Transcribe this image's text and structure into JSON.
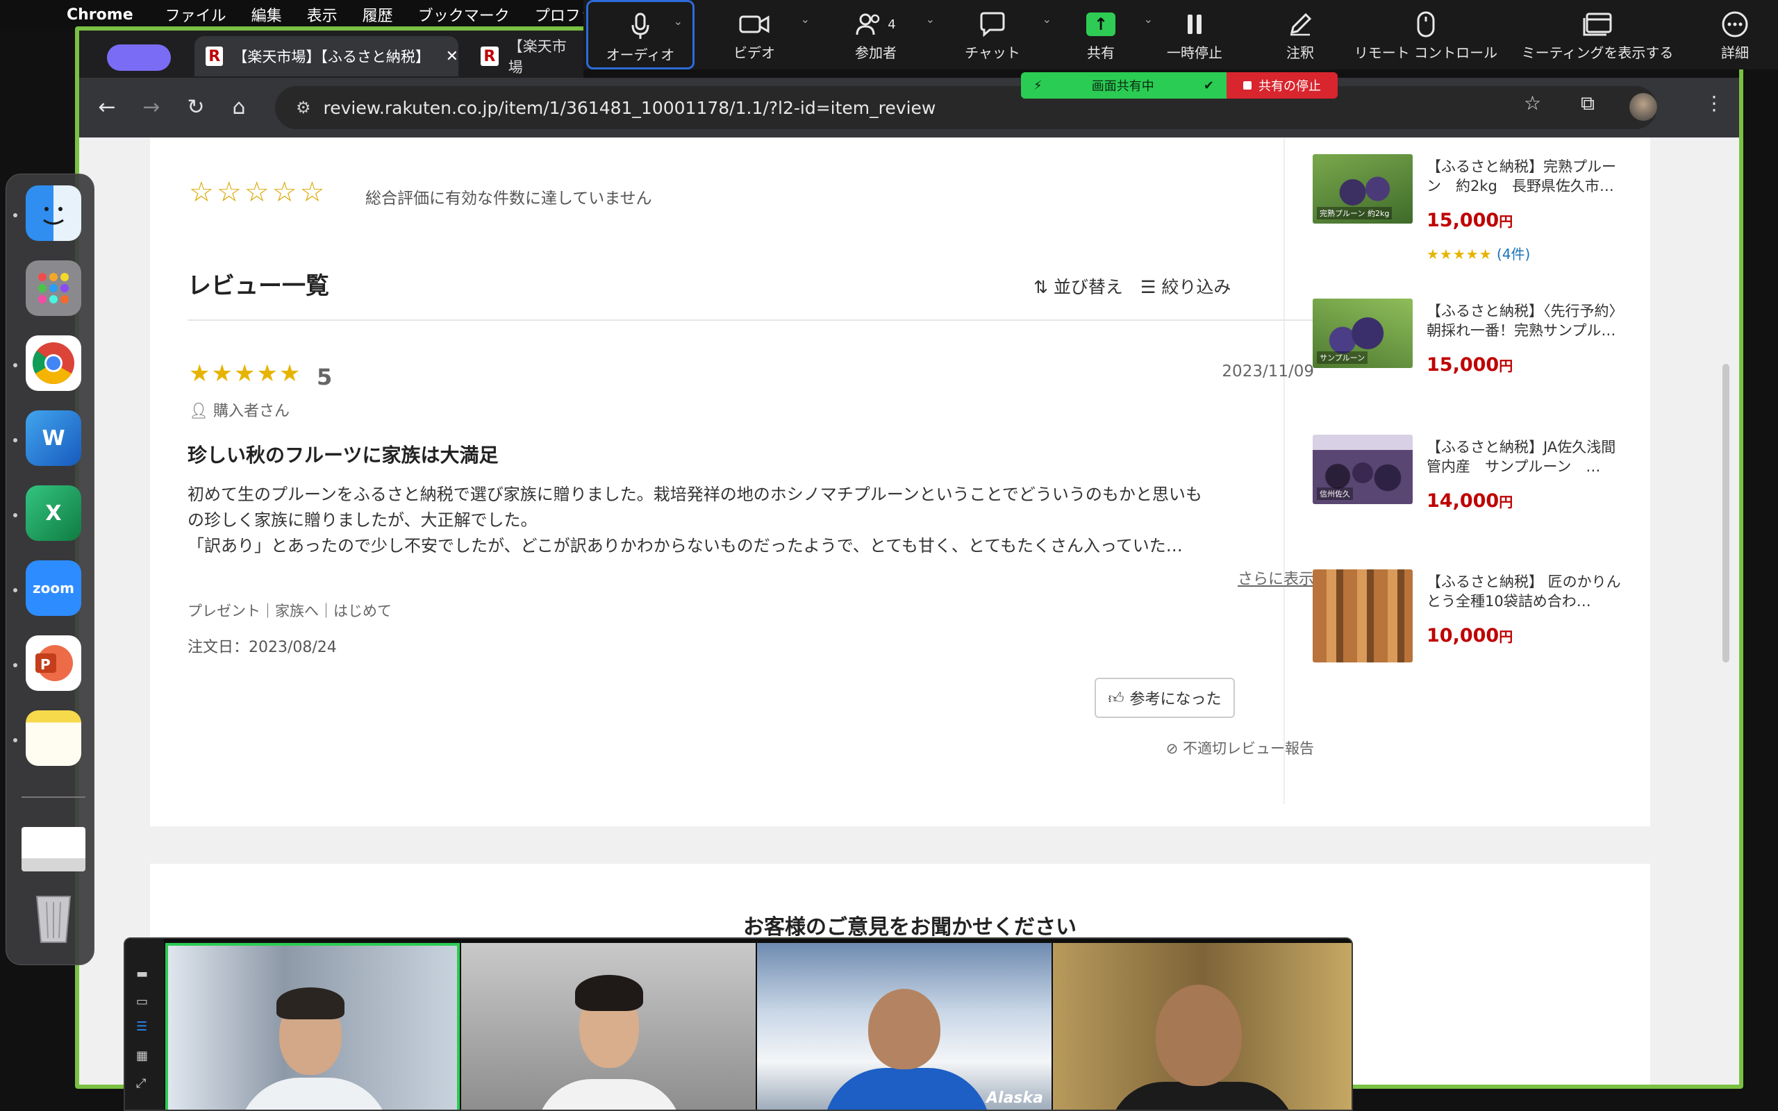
{
  "menubar": {
    "app": "Chrome",
    "menus": [
      "ファイル",
      "編集",
      "表示",
      "履歴",
      "ブックマーク",
      "プロファ"
    ]
  },
  "zoom": {
    "tools": {
      "audio": "オーディオ",
      "video": "ビデオ",
      "participants": "参加者",
      "participants_count": "4",
      "chat": "チャット",
      "share": "共有",
      "pause": "一時停止",
      "annotate": "注釈",
      "remote": "リモート コントロール",
      "show_meeting": "ミーティングを表示する",
      "more": "詳細"
    },
    "share_status": {
      "active": "画面共有中",
      "stop": "共有の停止"
    }
  },
  "browser": {
    "tabs": [
      {
        "title": "【楽天市場】【ふるさと納税】",
        "active": true
      },
      {
        "title": "【楽天市場",
        "active": false
      }
    ],
    "url": "review.rakuten.co.jp/item/1/361481_10001178/1.1/?l2-id=item_review"
  },
  "review_page": {
    "empty_stars": "☆☆☆☆☆",
    "no_rating_text": "総合評価に有効な件数に達していません",
    "list_title": "レビュー一覧",
    "sort_label": "並び替え",
    "filter_label": "絞り込み",
    "review": {
      "stars": "★★★★★",
      "score": "5",
      "date": "2023/11/09",
      "reviewer": "購入者さん",
      "title": "珍しい秋のフルーツに家族は大満足",
      "body": [
        "初めて生のプルーンをふるさと納税で選び家族に贈りました。栽培発祥の地のホシノマチプルーンということでどういうのもかと思いも",
        "の珍しく家族に贈りましたが、大正解でした。",
        "「訳あり」とあったので少し不安でしたが、どこが訳ありかわからないものだったようで、とても甘く、とてもたくさん入っていた…"
      ],
      "more": "さらに表示",
      "tags": "プレゼント｜家族へ｜はじめて",
      "order_date": "注文日：2023/08/24",
      "helpful": "参考になった",
      "report": "不適切レビュー報告"
    },
    "related_items": [
      {
        "title": "【ふるさと納税】完熟プルーン　約2kg　長野県佐久市…",
        "price": "15,000",
        "yen": "円",
        "stars": "★★★★★",
        "review_count": "(4件)",
        "thumb_label": "完熟プルーン 約2kg"
      },
      {
        "title": "【ふるさと納税】〈先行予約〉朝採れ一番！完熟サンプル…",
        "price": "15,000",
        "yen": "円",
        "thumb_label": "サンプルーン"
      },
      {
        "title": "【ふるさと納税】JA佐久浅間管内産　サンプルーン　…",
        "price": "14,000",
        "yen": "円",
        "thumb_label": "信州佐久"
      },
      {
        "title": "【ふるさと納税】 匠のかりんとう全種10袋詰め合わ…",
        "price": "10,000",
        "yen": "円"
      }
    ],
    "feedback_title": "お客様のご意見をお聞かせください"
  },
  "gallery": {
    "participants": 4,
    "watermark": "Alaska"
  },
  "colors": {
    "share_green": "#7ac143",
    "rakuten_red": "#bf0000",
    "star_gold": "#e6b400"
  }
}
